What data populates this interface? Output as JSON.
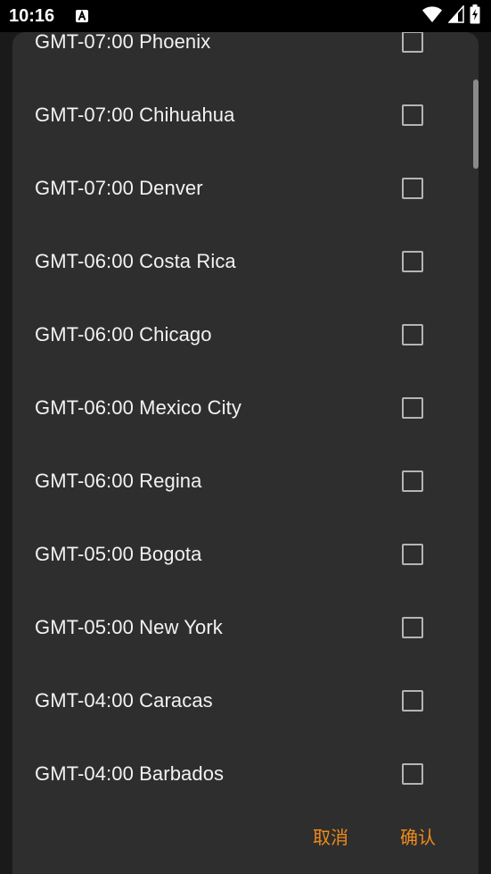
{
  "status_bar": {
    "time": "10:16",
    "notification_icon": "a-icon",
    "icons": [
      "wifi-icon",
      "signal-icon",
      "battery-charging-icon"
    ]
  },
  "dialog": {
    "items": [
      {
        "label": "GMT-07:00 Phoenix",
        "checked": false
      },
      {
        "label": "GMT-07:00 Chihuahua",
        "checked": false
      },
      {
        "label": "GMT-07:00 Denver",
        "checked": false
      },
      {
        "label": "GMT-06:00 Costa Rica",
        "checked": false
      },
      {
        "label": "GMT-06:00 Chicago",
        "checked": false
      },
      {
        "label": "GMT-06:00 Mexico City",
        "checked": false
      },
      {
        "label": "GMT-06:00 Regina",
        "checked": false
      },
      {
        "label": "GMT-05:00 Bogota",
        "checked": false
      },
      {
        "label": "GMT-05:00 New York",
        "checked": false
      },
      {
        "label": "GMT-04:00 Caracas",
        "checked": false
      },
      {
        "label": "GMT-04:00 Barbados",
        "checked": false
      }
    ],
    "cancel_label": "取消",
    "confirm_label": "确认",
    "accent_color": "#f08b1b"
  }
}
